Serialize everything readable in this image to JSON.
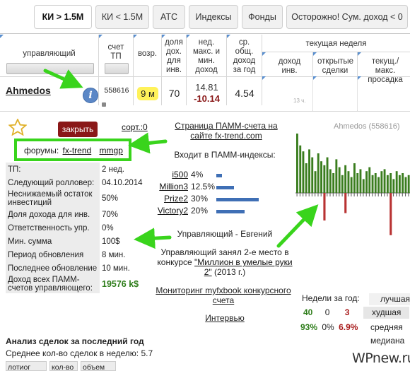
{
  "tabs": [
    "КИ > 1.5М",
    "КИ < 1.5М",
    "АТС",
    "Индексы",
    "Фонды",
    "Осторожно! Сум. доход < 0"
  ],
  "columns": {
    "manager": "управляющий",
    "account": "счет ТП",
    "age": "возр.",
    "share": "доля дох. для инв.",
    "max_income": "нед. макс. и мин. доход",
    "avg_income": "ср. общ. доход за год",
    "current_week": "текущая неделя",
    "investor_income": "доход инв.",
    "open_trades": "открытые сделки",
    "current_drawdown": "текущ./макс. просадка"
  },
  "row": {
    "manager_name": "Ahmedos",
    "info_icon": "i",
    "account_number": "558616",
    "age": "9 м",
    "share": "70",
    "max_income": "14.81",
    "min_income": "-10.14",
    "avg_income": "4.54",
    "time_note": "13 ч."
  },
  "detail": {
    "star_icon": "star-icon",
    "close_button": "закрыть",
    "sort_link": "сорт.:0",
    "forums_label": "форумы:",
    "forum_links": [
      "fx-trend",
      "mmgp"
    ],
    "params": [
      {
        "k": "ТП:",
        "v": "2 нед."
      },
      {
        "k": "Следующий ролловер:",
        "v": "04.10.2014"
      },
      {
        "k": "Неснижаемый остаток инвестиций",
        "v": "50%"
      },
      {
        "k": "Доля дохода для инв.",
        "v": "70%"
      },
      {
        "k": "Ответственность упр.",
        "v": "0%"
      },
      {
        "k": "Мин. сумма",
        "v": "100$"
      },
      {
        "k": "Период обновления",
        "v": "8 мин."
      },
      {
        "k": "Последнее обновление",
        "v": "10 мин."
      },
      {
        "k": "Доход всех ПАММ-счетов управляющего:",
        "v": "19576 k$"
      }
    ],
    "pamm_page_link": "Страница ПАММ-счета на сайте fx-trend.com",
    "indexes_title": "Входит в ПАММ-индексы:",
    "indexes": [
      {
        "name": "i500",
        "pct": "4%",
        "frac": 0.04
      },
      {
        "name": "Million3",
        "pct": "12.5%",
        "frac": 0.125
      },
      {
        "name": "Prize2",
        "pct": "30%",
        "frac": 0.3
      },
      {
        "name": "Victory2",
        "pct": "20%",
        "frac": 0.2
      }
    ],
    "manager_line": "Управляющий - Евгений",
    "contest_pre": "Управляющий занял 2-е место в конкурсе ",
    "contest_link": "\"Миллион в умелые руки 2\"",
    "contest_post": " (2013 г.)",
    "monitoring_link": "Мониторинг myfxbook конкурсного счета",
    "interview_link": "Интервью",
    "analysis_title": "Анализ сделок за последний год",
    "avg_trades": "Среднее кол-во сделок в неделю: 5.7",
    "trade_headers": [
      "лотиог",
      "кол-во",
      "объем"
    ],
    "weeks_title": "Недели за год:",
    "weeks_counts": [
      "40",
      "0",
      "3"
    ],
    "weeks_pcts": [
      "93%",
      "0%",
      "6.9%"
    ],
    "week_labels": [
      "лучшая",
      "худшая",
      "средняя",
      "медиана"
    ],
    "watermark": "WPnew.ru"
  },
  "chart_data": {
    "type": "bar",
    "title": "Ahmedos (558616)",
    "positive": [
      60,
      48,
      42,
      30,
      44,
      36,
      22,
      40,
      32,
      28,
      36,
      24,
      20,
      34,
      26,
      18,
      28,
      22,
      16,
      30,
      20,
      24,
      14,
      22,
      26,
      18,
      20,
      16,
      22,
      24,
      18,
      20,
      14,
      22,
      18,
      20,
      16,
      18
    ],
    "negative": [
      {
        "index": 9,
        "value": -30
      },
      {
        "index": 16,
        "value": -22
      },
      {
        "index": 31,
        "value": -46
      }
    ],
    "colors": {
      "positive": "#3a7d1e",
      "negative": "#b83232"
    }
  }
}
